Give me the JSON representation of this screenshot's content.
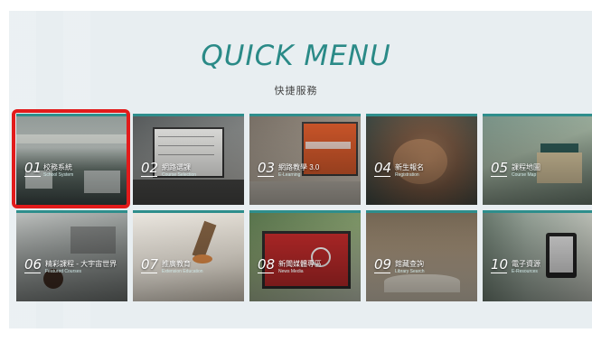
{
  "header": {
    "title": "QUICK MENU",
    "subtitle": "快捷服務"
  },
  "colors": {
    "accent": "#2a8a87",
    "highlight": "#e21b1b",
    "panel": "#e8eef1"
  },
  "tiles": [
    {
      "num": "01",
      "label": "校務系統",
      "en": "School System",
      "selected": true
    },
    {
      "num": "02",
      "label": "網路選課",
      "en": "Course Selection"
    },
    {
      "num": "03",
      "label": "網路教學 3.0",
      "en": "E-Learning"
    },
    {
      "num": "04",
      "label": "新生報名",
      "en": "Registration"
    },
    {
      "num": "05",
      "label": "課程地圖",
      "en": "Course Map"
    },
    {
      "num": "06",
      "label": "精彩課程 - 大宇宙世界",
      "en": "Featured Courses"
    },
    {
      "num": "07",
      "label": "推廣教育",
      "en": "Extension Education"
    },
    {
      "num": "08",
      "label": "新聞媒體專區",
      "en": "News Media"
    },
    {
      "num": "09",
      "label": "館藏查詢",
      "en": "Library Search"
    },
    {
      "num": "10",
      "label": "電子資源",
      "en": "E-Resources"
    }
  ]
}
